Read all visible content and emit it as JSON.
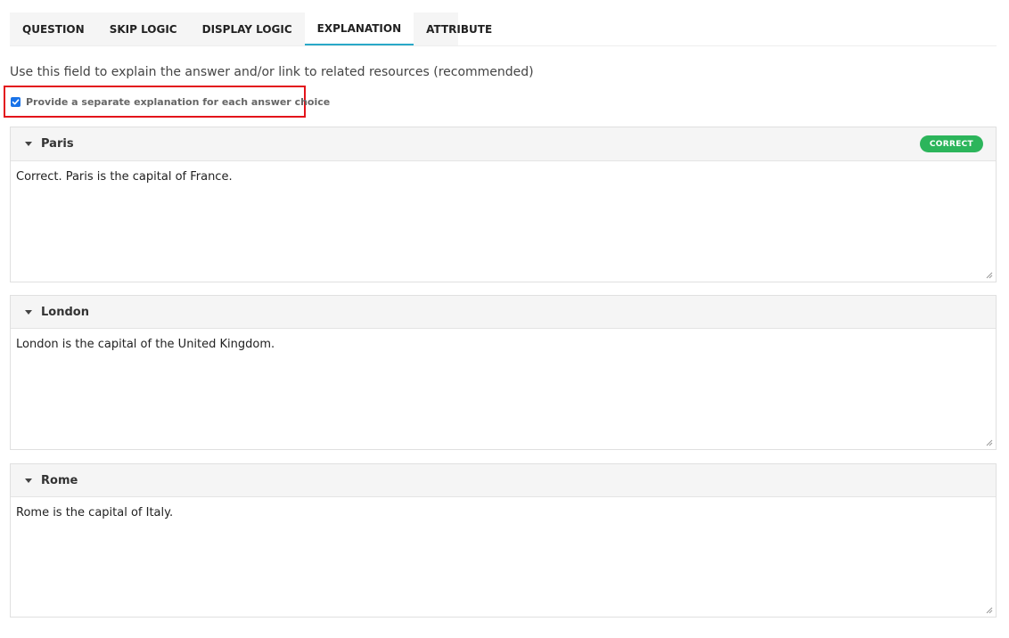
{
  "tabs": [
    {
      "label": "QUESTION",
      "active": false
    },
    {
      "label": "SKIP LOGIC",
      "active": false
    },
    {
      "label": "DISPLAY LOGIC",
      "active": false
    },
    {
      "label": "EXPLANATION",
      "active": true
    },
    {
      "label": "ATTRIBUTE",
      "active": false
    }
  ],
  "hint": "Use this field to explain the answer and/or link to related resources (recommended)",
  "separate_option": {
    "label": "Provide a separate explanation for each answer choice",
    "checked": true
  },
  "choices": [
    {
      "name": "Paris",
      "badge": "CORRECT",
      "explanation": "Correct. Paris is the capital of France."
    },
    {
      "name": "London",
      "badge": "",
      "explanation": "London is the capital of the United Kingdom."
    },
    {
      "name": "Rome",
      "badge": "",
      "explanation": "Rome is the capital of Italy."
    }
  ],
  "colors": {
    "accent": "#29a8c8",
    "correct_badge": "#2cb55b",
    "highlight_box": "#e3141b",
    "checkbox": "#1a73e8"
  }
}
